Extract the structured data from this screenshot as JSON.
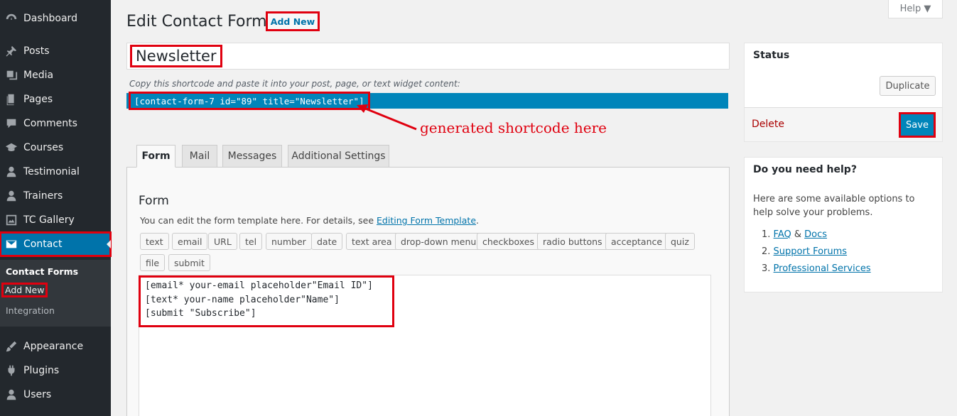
{
  "sidebar": {
    "items": [
      {
        "label": "Dashboard",
        "icon": "dashboard-icon"
      },
      {
        "label": "Posts",
        "icon": "pin-icon"
      },
      {
        "label": "Media",
        "icon": "media-icon"
      },
      {
        "label": "Pages",
        "icon": "pages-icon"
      },
      {
        "label": "Comments",
        "icon": "comment-icon"
      },
      {
        "label": "Courses",
        "icon": "graduation-cap-icon"
      },
      {
        "label": "Testimonial",
        "icon": "user-icon"
      },
      {
        "label": "Trainers",
        "icon": "user-icon"
      },
      {
        "label": "TC Gallery",
        "icon": "gallery-icon"
      },
      {
        "label": "Contact",
        "icon": "envelope-icon"
      },
      {
        "label": "Appearance",
        "icon": "brush-icon"
      },
      {
        "label": "Plugins",
        "icon": "plugin-icon"
      },
      {
        "label": "Users",
        "icon": "users-icon"
      }
    ],
    "submenu": [
      "Contact Forms",
      "Add New",
      "Integration"
    ]
  },
  "header": {
    "title": "Edit Contact Form",
    "add_new": "Add New",
    "help": "Help ▼"
  },
  "form_title": "Newsletter",
  "shortcode": {
    "description": "Copy this shortcode and paste it into your post, page, or text widget content:",
    "code": "[contact-form-7 id=\"89\" title=\"Newsletter\"]",
    "annotation": "generated shortcode here"
  },
  "tabs": [
    "Form",
    "Mail",
    "Messages",
    "Additional Settings"
  ],
  "panel": {
    "heading": "Form",
    "desc_prefix": "You can edit the form template here. For details, see ",
    "desc_link": "Editing Form Template",
    "desc_suffix": ".",
    "tag_buttons": [
      "text",
      "email",
      "URL",
      "tel",
      "number",
      "date",
      "text area",
      "drop-down menu",
      "checkboxes",
      "radio buttons",
      "acceptance",
      "quiz",
      "file",
      "submit"
    ],
    "template_lines": [
      "[email* your-email placeholder\"Email ID\"]",
      "[text* your-name placeholder\"Name\"]",
      "[submit \"Subscribe\"]"
    ]
  },
  "status": {
    "title": "Status",
    "duplicate": "Duplicate",
    "delete": "Delete",
    "save": "Save"
  },
  "help_box": {
    "title": "Do you need help?",
    "text": "Here are some available options to help solve your problems.",
    "items": [
      {
        "num": "1.",
        "link1": "FAQ",
        "amp": " & ",
        "link2": "Docs"
      },
      {
        "num": "2.",
        "link1": "Support Forums"
      },
      {
        "num": "3.",
        "link1": "Professional Services"
      }
    ]
  },
  "colors": {
    "sidebar_bg": "#23282d",
    "accent": "#0073aa",
    "highlight": "#e0000f"
  }
}
